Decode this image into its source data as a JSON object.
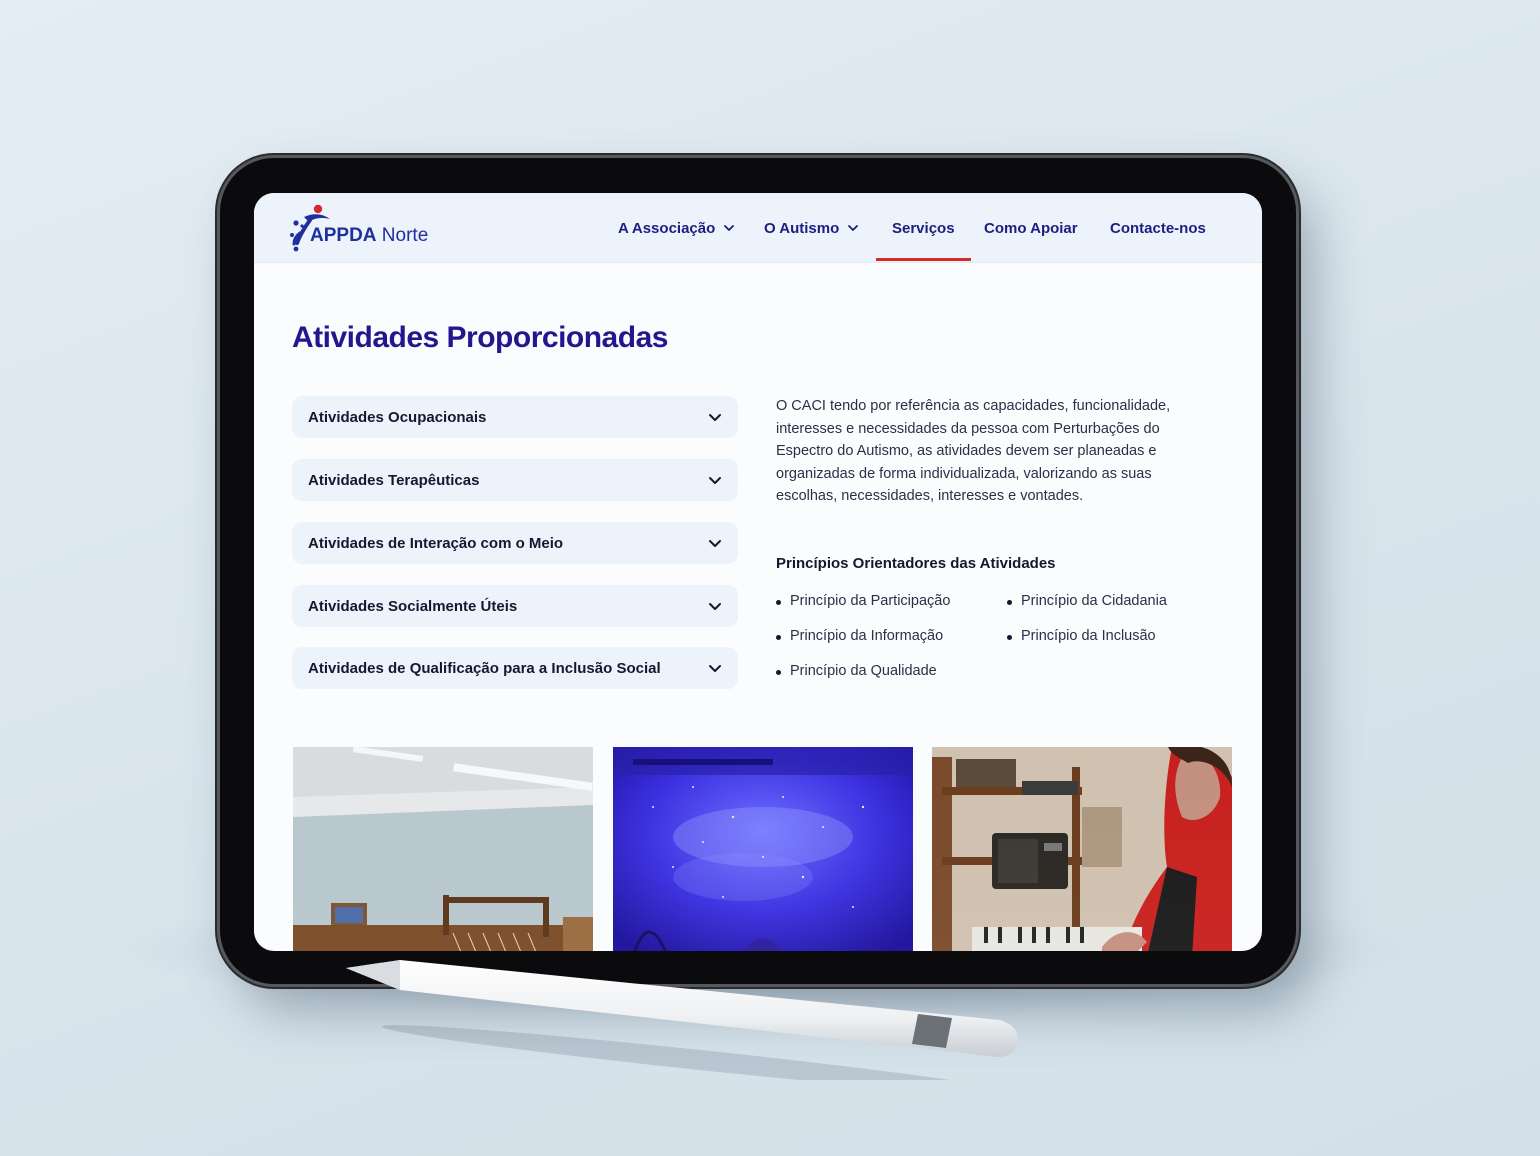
{
  "site": {
    "logo_primary": "APPDA",
    "logo_secondary": "Norte"
  },
  "nav": {
    "items": [
      {
        "label": "A Associação",
        "has_dropdown": true
      },
      {
        "label": "O Autismo",
        "has_dropdown": true
      },
      {
        "label": "Serviços",
        "has_dropdown": false,
        "active": true
      },
      {
        "label": "Como Apoiar",
        "has_dropdown": false
      },
      {
        "label": "Contacte-nos",
        "has_dropdown": false
      }
    ]
  },
  "main": {
    "title": "Atividades Proporcionadas",
    "accordion": [
      {
        "label": "Atividades Ocupacionais"
      },
      {
        "label": "Atividades Terapêuticas"
      },
      {
        "label": "Atividades de Interação com o Meio"
      },
      {
        "label": "Atividades Socialmente Úteis"
      },
      {
        "label": "Atividades de Qualificação para a Inclusão Social"
      }
    ],
    "description": "O CACI tendo por referência as capacidades, funcionalidade, interesses e necessidades da pessoa com Perturbações do Espectro do Autismo, as atividades devem ser planeadas e organizadas de forma individualizada, valorizando as suas escolhas, necessidades, interesses e vontades.",
    "principles_title": "Princípios Orientadores das Atividades",
    "principles": [
      "Princípio da Participação",
      "Princípio da Cidadania",
      "Princípio da Informação",
      "Princípio da Inclusão",
      "Princípio da Qualidade"
    ]
  },
  "colors": {
    "brand_navy": "#22178f",
    "brand_blue": "#1f2f9e",
    "accent_red": "#d42a2a",
    "panel_bg": "#edf3fb"
  },
  "icons": {
    "dropdown": "chevron-down-icon",
    "logo": "appda-figure-icon"
  }
}
